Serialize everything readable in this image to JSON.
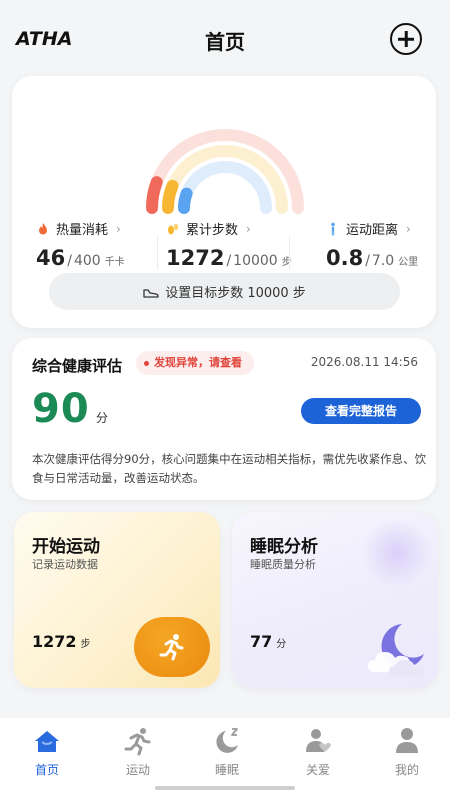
{
  "header": {
    "logo": "ATHA",
    "title": "首页"
  },
  "activity": {
    "calories": {
      "label": "热量消耗",
      "value": "46",
      "target": "400",
      "unit": "千卡"
    },
    "steps": {
      "label": "累计步数",
      "value": "1272",
      "target": "10000",
      "unit": "步"
    },
    "distance": {
      "label": "运动距离",
      "value": "0.8",
      "target": "7.0",
      "unit": "公里"
    },
    "goal_button": "设置目标步数 10000 步",
    "ring_progress": {
      "calories": 0.115,
      "steps": 0.127,
      "distance": 0.114
    },
    "ring_colors": {
      "calories": "#f06a5c",
      "steps": "#f7b733",
      "distance": "#5aa3f0"
    }
  },
  "health": {
    "title": "综合健康评估",
    "alert": "发现异常，请查看",
    "time": "2026.08.11 14:56",
    "score": "90",
    "score_unit": "分",
    "report_button": "查看完整报告",
    "description": "本次健康评估得分90分，核心问题集中在运动相关指标，需优先收紧作息、饮食与日常活动量，改善运动状态。",
    "score_color": "#1b8a55",
    "alert_color": "#e0443c"
  },
  "sport_card": {
    "title": "开始运动",
    "subtitle": "记录运动数据",
    "value": "1272",
    "unit": "步",
    "icon": "running-icon"
  },
  "sleep_card": {
    "title": "睡眠分析",
    "subtitle": "睡眠质量分析",
    "value": "77",
    "unit": "分",
    "icon": "moon-cloud-icon"
  },
  "tabs": [
    {
      "label": "首页",
      "icon": "home-icon",
      "active": true
    },
    {
      "label": "运动",
      "icon": "running-icon",
      "active": false
    },
    {
      "label": "睡眠",
      "icon": "sleep-icon",
      "active": false
    },
    {
      "label": "关爱",
      "icon": "care-icon",
      "active": false
    },
    {
      "label": "我的",
      "icon": "profile-icon",
      "active": false
    }
  ],
  "accent_color": "#1d63d8"
}
